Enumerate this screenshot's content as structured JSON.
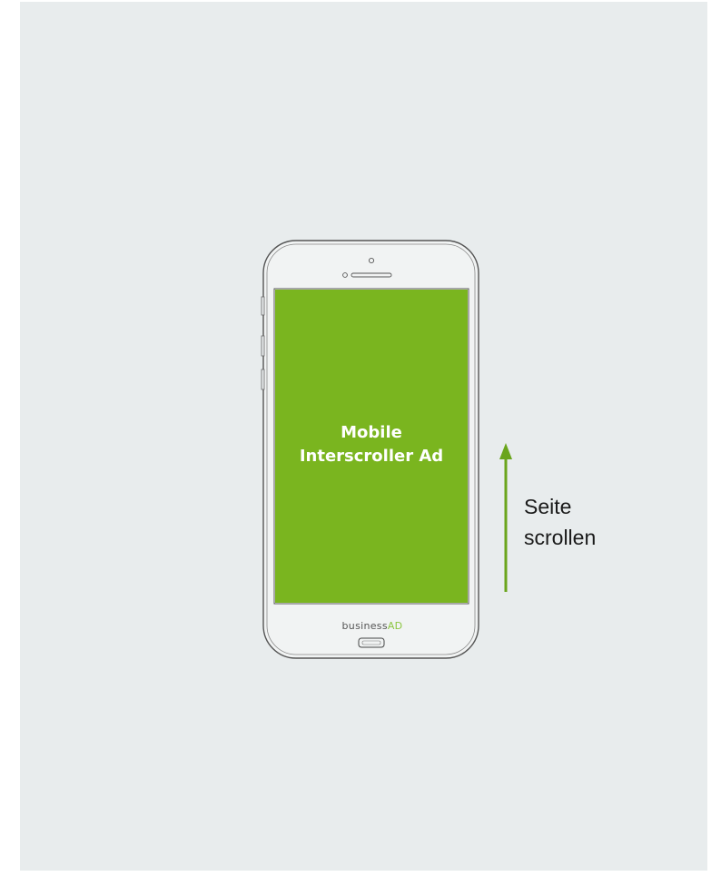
{
  "ad": {
    "line1": "Mobile",
    "line2": "Interscroller Ad"
  },
  "scroll": {
    "line1": "Seite",
    "line2": "scrollen"
  },
  "brand": {
    "prefix": "business",
    "suffix": "AD"
  },
  "colors": {
    "background": "#e8eced",
    "ad_screen": "#7ab51f",
    "arrow": "#6aa51c",
    "phone_outline": "#555555"
  },
  "icons": {
    "arrow": "arrow-up-icon",
    "phone": "smartphone-icon"
  }
}
